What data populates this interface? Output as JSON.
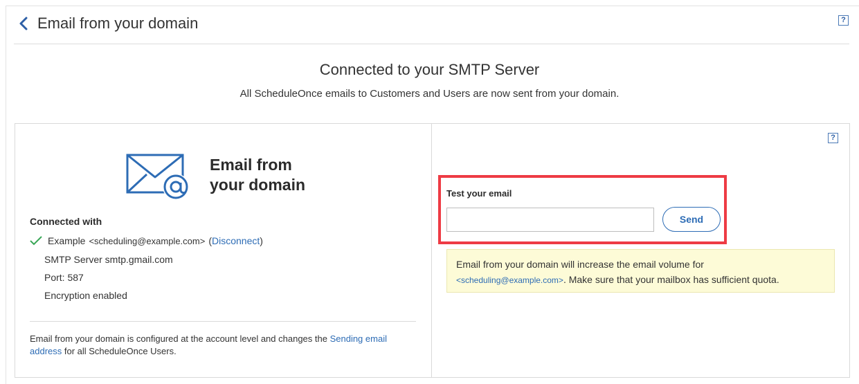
{
  "header": {
    "title": "Email from your domain",
    "back_icon": "chevron-left-icon",
    "help_label": "?"
  },
  "status": {
    "headline": "Connected to your SMTP Server",
    "subline": "All ScheduleOnce emails to Customers and Users are now sent from your domain."
  },
  "left_panel": {
    "logo_text_line1": "Email from",
    "logo_text_line2": "your domain",
    "connected_title": "Connected with",
    "account_name": "Example",
    "account_email": "<scheduling@example.com>",
    "open_paren": "(",
    "disconnect_label": "Disconnect",
    "close_paren": ")",
    "smtp_server": "SMTP Server smtp.gmail.com",
    "port": "Port: 587",
    "encryption": "Encryption enabled",
    "footnote_prefix": "Email from your domain is configured at the account level and changes the ",
    "footnote_link": "Sending email address",
    "footnote_suffix": " for all ScheduleOnce Users."
  },
  "right_panel": {
    "help_label": "?",
    "test_label": "Test your email",
    "test_input_value": "",
    "test_input_placeholder": "",
    "send_label": "Send",
    "notice_line1": "Email from your domain will increase the email volume for",
    "notice_email": "<scheduling@example.com>",
    "notice_line2": ". Make sure that your mailbox has sufficient quota."
  },
  "colors": {
    "accent": "#2d6cb5",
    "highlight_border": "#ee3b44",
    "check_green": "#3aa757",
    "notice_bg": "#fdfbd7"
  }
}
